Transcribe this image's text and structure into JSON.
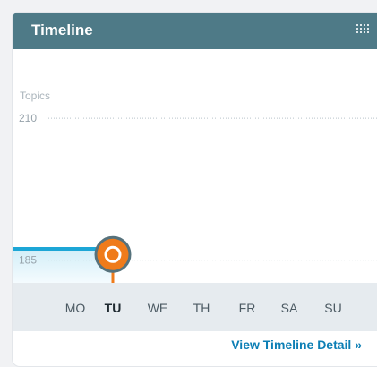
{
  "widget": {
    "title": "Timeline",
    "menu_icon": "grid-menu-icon",
    "link_label": "View Timeline Detail »"
  },
  "colors": {
    "header": "#4e7a87",
    "line": "#1ca6d6",
    "accent": "#ef7b1b"
  },
  "chart_data": {
    "type": "line",
    "ylabel": "Topics",
    "yticks": [
      210,
      185
    ],
    "ylim": [
      181,
      219
    ],
    "categories": [
      "MO",
      "TU",
      "WE",
      "TH",
      "FR",
      "SA",
      "SU"
    ],
    "values": [
      187,
      186
    ],
    "selected_index": 1
  }
}
